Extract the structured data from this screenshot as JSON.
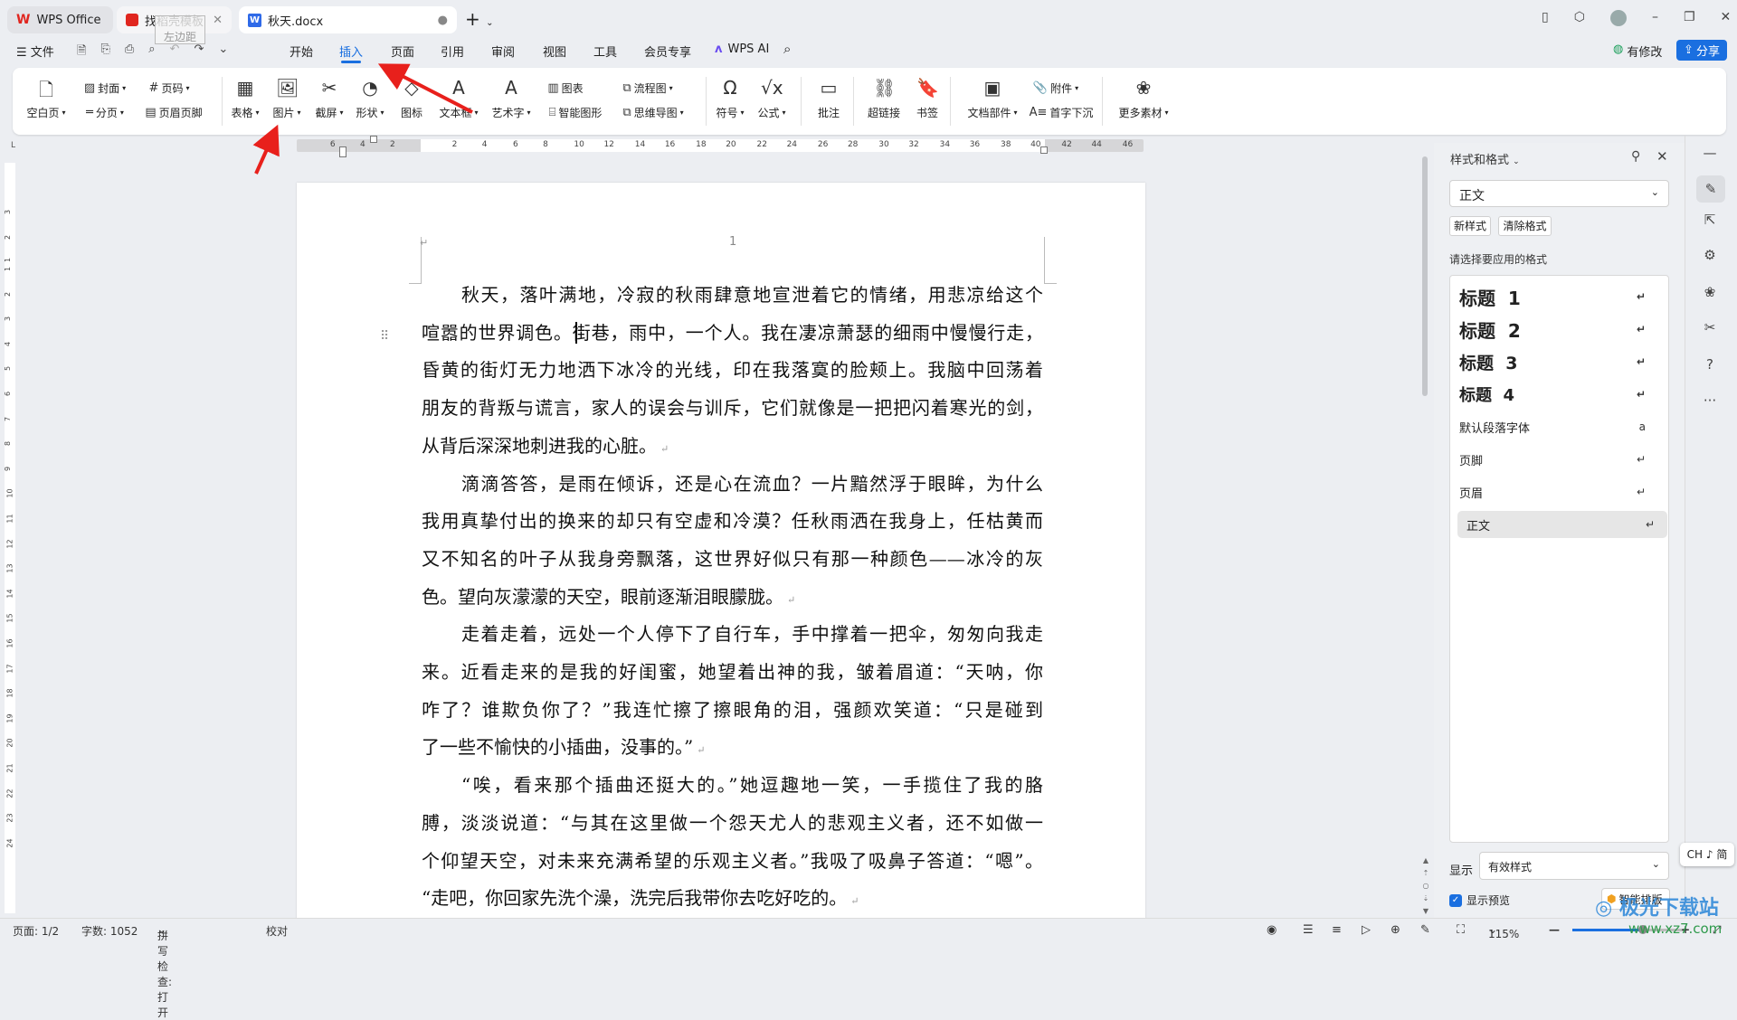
{
  "tabs": [
    {
      "label": "WPS Office"
    },
    {
      "label": "找稻壳模板"
    },
    {
      "label": "秋天.docx"
    }
  ],
  "tooltip": "左边距",
  "menu": {
    "file": "文件",
    "items": [
      "开始",
      "插入",
      "页面",
      "引用",
      "审阅",
      "视图",
      "工具",
      "会员专享"
    ],
    "active": "插入",
    "ai": "WPS AI",
    "modified": "有修改",
    "share": "分享"
  },
  "ribbon": {
    "blank_page": "空白页",
    "cover": "封面",
    "page_number": "页码",
    "page_break": "分页",
    "header_footer": "页眉页脚",
    "table": "表格",
    "picture": "图片",
    "screenshot": "截屏",
    "shape": "形状",
    "icon": "图标",
    "textbox": "文本框",
    "wordart": "艺术字",
    "chart": "图表",
    "smartart": "智能图形",
    "flowchart": "流程图",
    "mindmap": "思维导图",
    "symbol": "符号",
    "formula": "公式",
    "comment": "批注",
    "hyperlink": "超链接",
    "bookmark": "书签",
    "doc_parts": "文档部件",
    "attachment": "附件",
    "drop_cap": "首字下沉",
    "more": "更多素材"
  },
  "ruler": {
    "ticks": [
      "6",
      "4",
      "2",
      "2",
      "4",
      "6",
      "8",
      "10",
      "12",
      "14",
      "16",
      "18",
      "20",
      "22",
      "24",
      "26",
      "28",
      "30",
      "32",
      "34",
      "36",
      "38",
      "40",
      "42",
      "44",
      "46"
    ]
  },
  "vruler": [
    "3",
    "2",
    "1",
    "1",
    "2",
    "3",
    "4",
    "5",
    "6",
    "7",
    "8",
    "9",
    "10",
    "11",
    "12",
    "13",
    "14",
    "15",
    "16",
    "17",
    "18",
    "19",
    "20",
    "21",
    "22",
    "23",
    "24"
  ],
  "document": {
    "page_number": "1",
    "lines": [
      {
        "t": "秋天，落叶满地，冷寂的秋雨肆意地宣泄着它的情绪，用悲凉给这个",
        "indent": true
      },
      {
        "t": "喧嚣的世界调色。街巷，雨中，一个人。我在凄凉萧瑟的细雨中慢慢行走，"
      },
      {
        "t": "昏黄的街灯无力地洒下冰冷的光线，印在我落寞的脸颊上。我脑中回荡着"
      },
      {
        "t": "朋友的背叛与谎言，家人的误会与训斥，它们就像是一把把闪着寒光的剑，"
      },
      {
        "t": "从背后深深地刺进我的心脏。",
        "last": true
      },
      {
        "t": "滴滴答答，是雨在倾诉，还是心在流血？一片黯然浮于眼眸，为什么",
        "indent": true
      },
      {
        "t": "我用真挚付出的换来的却只有空虚和冷漠？任秋雨洒在我身上，任枯黄而"
      },
      {
        "t": "又不知名的叶子从我身旁飘落，这世界好似只有那一种颜色——冰冷的灰"
      },
      {
        "t": "色。望向灰濛濛的天空，眼前逐渐泪眼朦胧。",
        "last": true
      },
      {
        "t": "走着走着，远处一个人停下了自行车，手中撑着一把伞，匆匆向我走",
        "indent": true
      },
      {
        "t": "来。近看走来的是我的好闺蜜，她望着出神的我，皱着眉道：“天呐，你"
      },
      {
        "t": "咋了？谁欺负你了？”我连忙擦了擦眼角的泪，强颜欢笑道：“只是碰到"
      },
      {
        "t": "了一些不愉快的小插曲，没事的。”",
        "last": true
      },
      {
        "t": "“唉，看来那个插曲还挺大的。”她逗趣地一笑，一手揽住了我的胳",
        "indent": true
      },
      {
        "t": "膊，淡淡说道：“与其在这里做一个怨天尤人的悲观主义者，还不如做一"
      },
      {
        "t": "个仰望天空，对未来充满希望的乐观主义者。”我吸了吸鼻子答道：“嗯”。"
      },
      {
        "t": "“走吧，你回家先洗个澡，洗完后我带你去吃好吃的。",
        "last": true
      }
    ]
  },
  "panel": {
    "title": "样式和格式",
    "current": "正文",
    "new_style": "新样式",
    "clear_format": "清除格式",
    "prompt": "请选择要应用的格式",
    "styles": [
      {
        "label": "标题  1",
        "kind": "h1"
      },
      {
        "label": "标题  2",
        "kind": "h2"
      },
      {
        "label": "标题  3",
        "kind": "h3"
      },
      {
        "label": "标题  4",
        "kind": "h4"
      },
      {
        "label": "默认段落字体",
        "kind": "char"
      },
      {
        "label": "页脚",
        "kind": "p"
      },
      {
        "label": "页眉",
        "kind": "p"
      },
      {
        "label": "正文",
        "kind": "p",
        "selected": true
      }
    ],
    "show_label": "显示",
    "show_value": "有效样式",
    "preview_label": "显示预览",
    "smart_layout": "智能排版"
  },
  "ime": "CH ♪ 简",
  "watermark": "极光下载站",
  "watermark_url": "www.xz7.com",
  "status": {
    "page": "页面: 1/2",
    "words": "字数: 1052",
    "spell": "拼写检查: 打开",
    "proof": "校对",
    "zoom": "115%"
  },
  "colors": {
    "accent": "#1a6fe0",
    "arrow": "#e8201c"
  }
}
